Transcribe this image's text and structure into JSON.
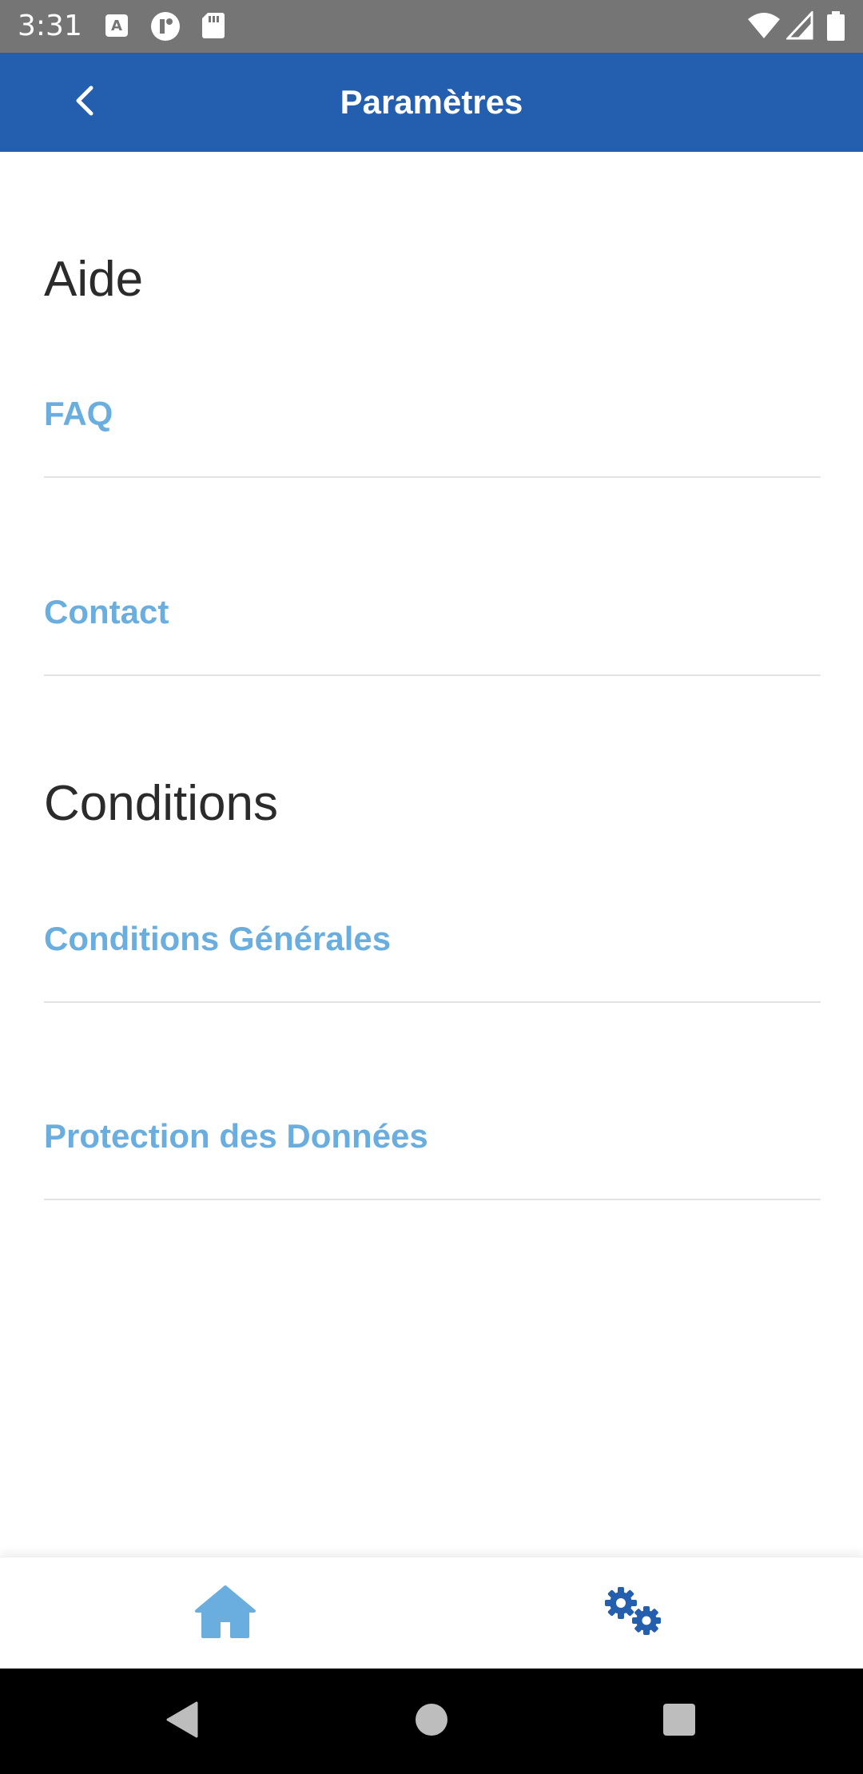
{
  "status_bar": {
    "time": "3:31",
    "icons": [
      "keyboard-a-icon",
      "app-notification-icon",
      "sd-card-icon",
      "wifi-icon",
      "signal-icon",
      "battery-icon"
    ]
  },
  "app_bar": {
    "title": "Paramètres",
    "back_icon": "chevron-left-icon",
    "color": "#245eae"
  },
  "sections": [
    {
      "title": "Aide",
      "items": [
        {
          "label": "FAQ"
        },
        {
          "label": "Contact"
        }
      ]
    },
    {
      "title": "Conditions",
      "items": [
        {
          "label": "Conditions Générales"
        },
        {
          "label": "Protection des Données"
        }
      ]
    }
  ],
  "link_color": "#6aaee0",
  "bottom_nav": {
    "items": [
      {
        "icon": "home-icon",
        "color": "#6aaee0"
      },
      {
        "icon": "gears-icon",
        "color": "#245eae"
      }
    ]
  },
  "system_nav": [
    "back-triangle-icon",
    "home-circle-icon",
    "recents-square-icon"
  ]
}
